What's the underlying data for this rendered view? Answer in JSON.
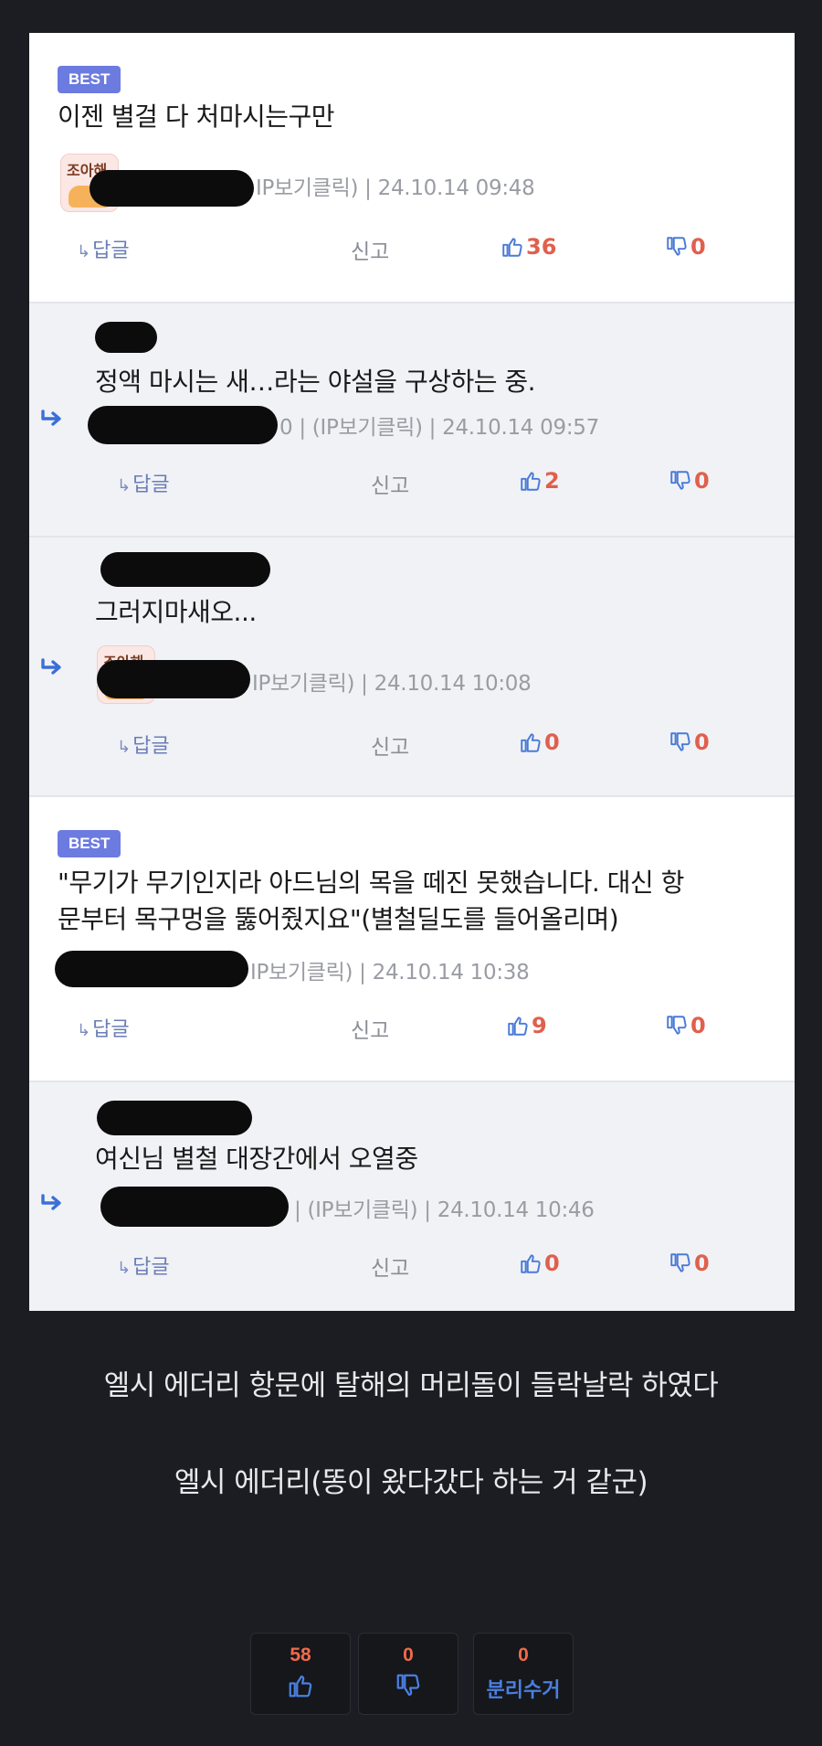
{
  "comments": [
    {
      "best": "BEST",
      "text": "이젠 별걸 다 처마시는구만",
      "meta": "IP보기클릭) | 24.10.14 09:48",
      "reply_label": "답글",
      "report_label": "신고",
      "likes": "36",
      "dislikes": "0"
    },
    {
      "text": "정액 마시는 새…라는 야설을 구상하는 중.",
      "meta": "0 | (IP보기클릭) | 24.10.14 09:57",
      "reply_label": "답글",
      "report_label": "신고",
      "likes": "2",
      "dislikes": "0"
    },
    {
      "text": "그러지마새오...",
      "meta": "IP보기클릭) | 24.10.14 10:08",
      "reply_label": "답글",
      "report_label": "신고",
      "likes": "0",
      "dislikes": "0"
    },
    {
      "best": "BEST",
      "text_line1": "\"무기가 무기인지라 아드님의 목을 떼진 못했습니다. 대신 항",
      "text_line2": "문부터 목구멍을 뚫어줬지요\"(별철딜도를 들어올리며)",
      "meta": "IP보기클릭) | 24.10.14 10:38",
      "reply_label": "답글",
      "report_label": "신고",
      "likes": "9",
      "dislikes": "0"
    },
    {
      "text": "여신님 별철 대장간에서 오열중",
      "meta": "| (IP보기클릭) | 24.10.14 10:46",
      "reply_label": "답글",
      "report_label": "신고",
      "likes": "0",
      "dislikes": "0"
    }
  ],
  "avatar_text": "조아해",
  "post_body": {
    "line1": "엘시 에더리 항문에 탈해의 머리돌이 들락날락 하였다",
    "line2": "엘시 에더리(똥이 왔다갔다 하는 거 같군)"
  },
  "votes": {
    "up": "58",
    "down": "0",
    "recycle_count": "0",
    "recycle_label": "분리수거"
  },
  "icons": [
    "thumbs-up-icon",
    "thumbs-down-icon",
    "reply-arrow-icon"
  ],
  "colors": {
    "best_badge": "#6c7be0",
    "vote_count": "#e0604d",
    "reply_arrow": "#3b6fd8",
    "page_bg": "#1b1d22"
  }
}
